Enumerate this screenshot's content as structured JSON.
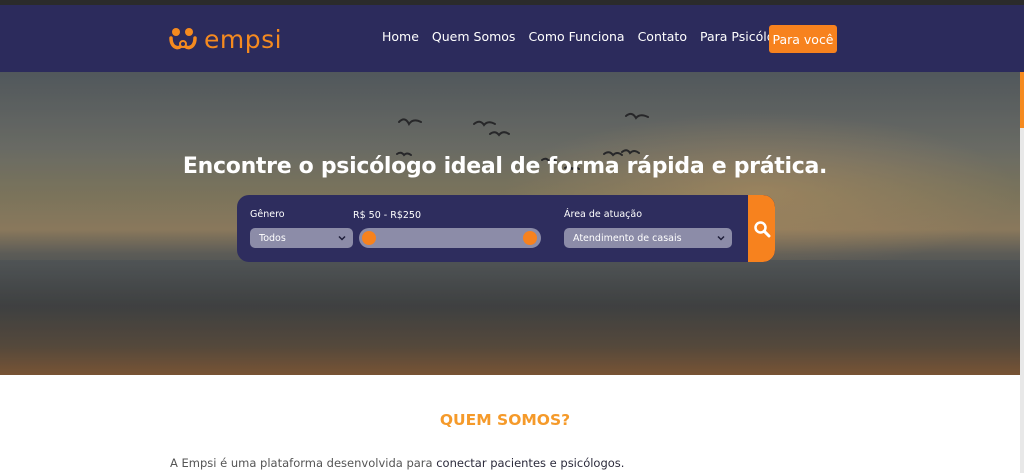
{
  "brand": {
    "name": "empsi",
    "logo_icon": "empsi-logo-mark",
    "color": "#f58a1f"
  },
  "nav": {
    "items": [
      {
        "label": "Home"
      },
      {
        "label": "Quem Somos"
      },
      {
        "label": "Como Funciona"
      },
      {
        "label": "Contato"
      },
      {
        "label": "Para Psicólogos"
      }
    ],
    "cta_label": "Para você",
    "bg_color": "#2c2b5c",
    "accent": "#f7821e"
  },
  "hero": {
    "headline": "Encontre o psicólogo ideal de forma rápida e prática."
  },
  "search": {
    "gender": {
      "label": "Gênero",
      "value": "Todos"
    },
    "price": {
      "label": "R$ 50 - R$250",
      "min": 50,
      "max": 250
    },
    "area": {
      "label": "Área de atuação",
      "value": "Atendimento de casais"
    },
    "button_icon": "search-icon"
  },
  "about": {
    "title": "QUEM SOMOS?",
    "text_prefix": "A Empsi é uma plataforma desenvolvida para ",
    "text_bold": "conectar pacientes e psicólogos."
  }
}
